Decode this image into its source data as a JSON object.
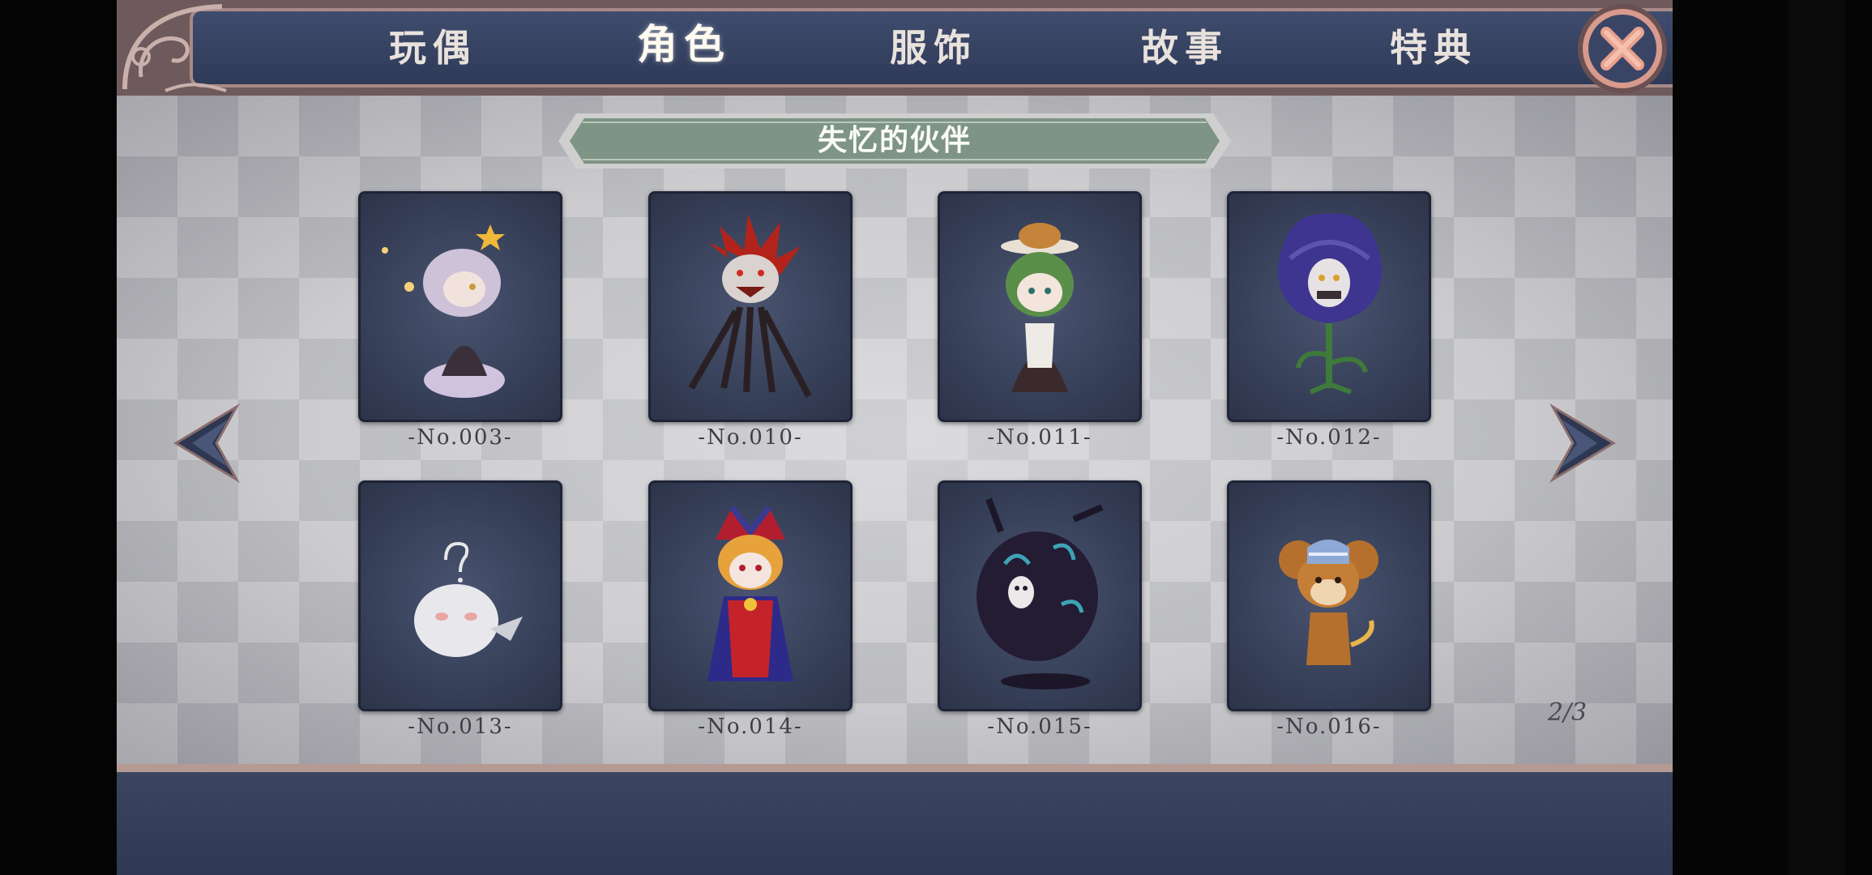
{
  "nav": {
    "tabs": [
      {
        "label": "玩偶",
        "active": false
      },
      {
        "label": "角色",
        "active": true
      },
      {
        "label": "服饰",
        "active": false
      },
      {
        "label": "故事",
        "active": false
      },
      {
        "label": "特典",
        "active": false
      }
    ]
  },
  "section_title": "失忆的伙伴",
  "characters": [
    {
      "label": "-No.003-",
      "icon": "lavender-haired-girl-portrait"
    },
    {
      "label": "-No.010-",
      "icon": "red-haired-spider-creature-portrait"
    },
    {
      "label": "-No.011-",
      "icon": "green-haired-maid-portrait"
    },
    {
      "label": "-No.012-",
      "icon": "purple-rose-monster-portrait"
    },
    {
      "label": "-No.013-",
      "icon": "white-fluffy-creature-portrait"
    },
    {
      "label": "-No.014-",
      "icon": "jester-clown-portrait"
    },
    {
      "label": "-No.015-",
      "icon": "dark-shadow-beast-portrait"
    },
    {
      "label": "-No.016-",
      "icon": "brown-mouse-portrait"
    }
  ],
  "pagination": {
    "text": "2/3"
  },
  "colors": {
    "nav_bg": "#35405f",
    "frame": "#a88a86",
    "card_bg": "#343d55",
    "banner": "#7e9484",
    "close_ring": "#d79a8c"
  }
}
